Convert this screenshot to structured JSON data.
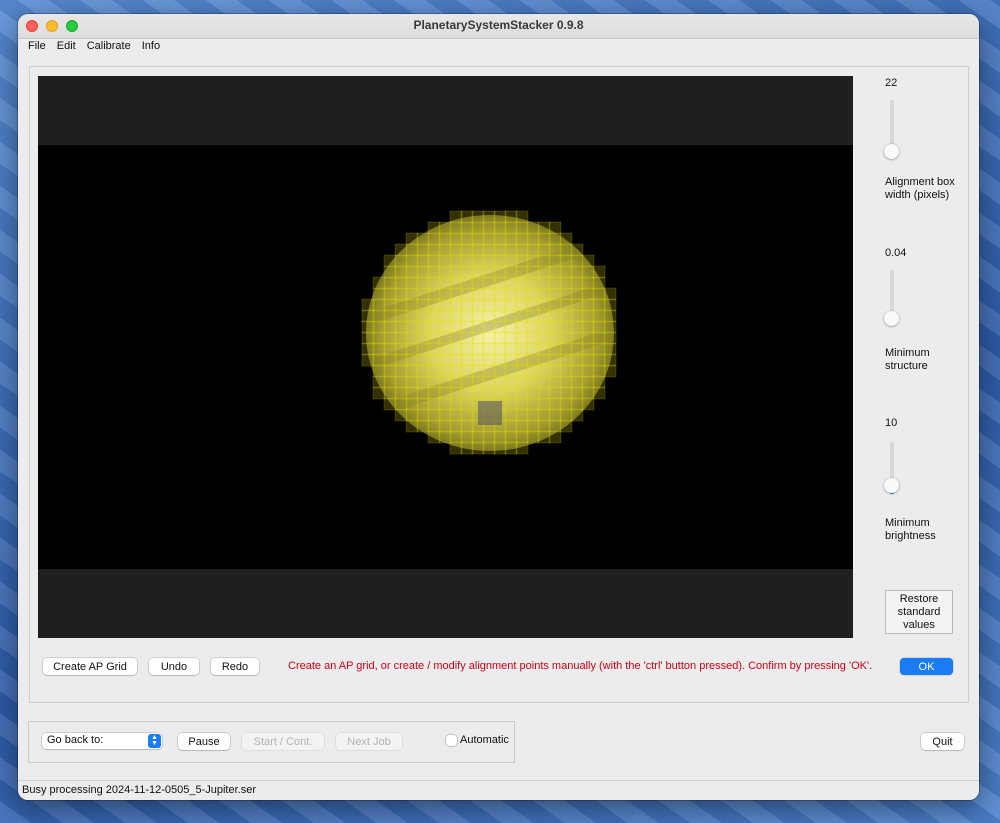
{
  "window": {
    "title": "PlanetarySystemStacker 0.9.8"
  },
  "menu": [
    "File",
    "Edit",
    "Calibrate",
    "Info"
  ],
  "sliders": [
    {
      "value_text": "22",
      "label": "Alignment box width (pixels)",
      "level": 0
    },
    {
      "value_text": "0.04",
      "label": "Minimum structure",
      "level": 0.1
    },
    {
      "value_text": "10",
      "label": "Minimum brightness",
      "level": 0.1
    }
  ],
  "buttons": {
    "restore": "Restore\nstandard\nvalues",
    "create_ap_grid": "Create AP Grid",
    "undo": "Undo",
    "redo": "Redo",
    "ok": "OK",
    "pause": "Pause",
    "start_cont": "Start / Cont.",
    "next_job": "Next Job",
    "quit": "Quit"
  },
  "message": "Create an AP grid, or create / modify alignment points manually (with the 'ctrl' button pressed). Confirm by pressing 'OK'.",
  "go_back": {
    "selected": "Go back to:"
  },
  "automatic": {
    "label": "Automatic",
    "checked": false
  },
  "status": "Busy processing 2024-11-12-0505_5-Jupiter.ser",
  "colors": {
    "accent": "#1a7cf4",
    "message": "#d0011b",
    "ap_box": "#e8e000"
  }
}
